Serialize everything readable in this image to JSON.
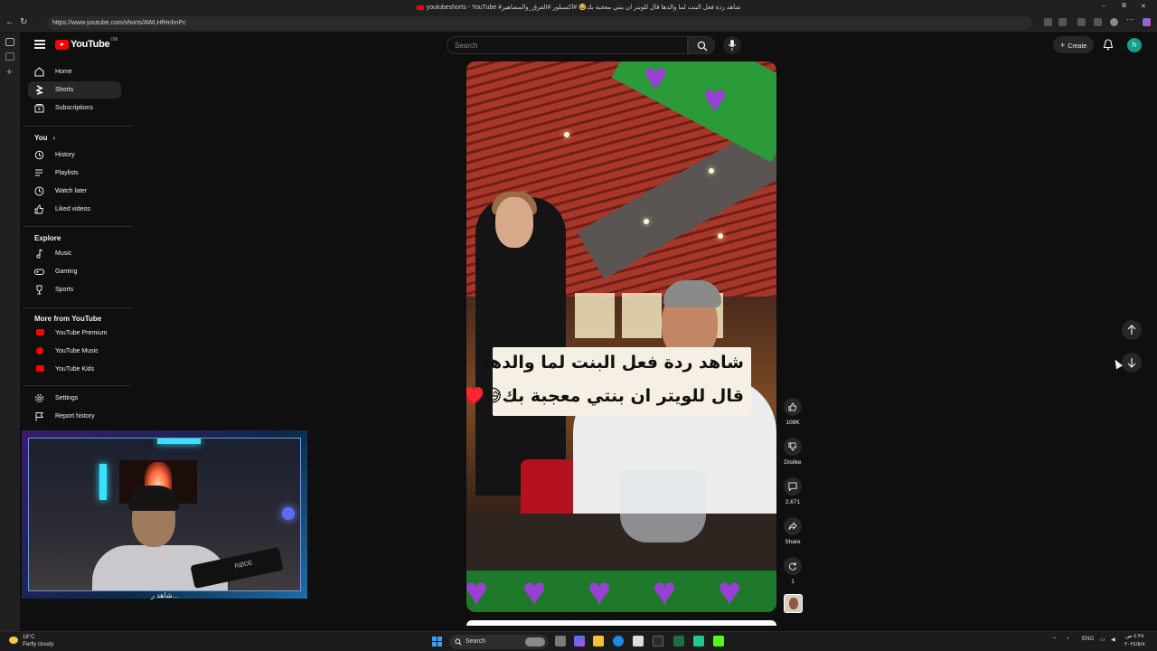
{
  "browser": {
    "tab_title": "youtubeshorts - YouTube #شاهد ردة فعل البنت لما والدها قال للويتر ان بنتي معجبة بك😂 #اكسبلور #الفرق_والمشاهير",
    "url": "https://www.youtube.com/shorts/AWLHfHnhnPc",
    "window_controls": [
      "–",
      "⧉",
      "✕"
    ]
  },
  "header": {
    "logo_text": "YouTube",
    "logo_region": "OM",
    "search_placeholder": "Search",
    "create_label": "Create",
    "avatar_letter": "h"
  },
  "sidebar": {
    "main": [
      {
        "label": "Home",
        "icon": "home-icon"
      },
      {
        "label": "Shorts",
        "icon": "shorts-icon",
        "active": true
      },
      {
        "label": "Subscriptions",
        "icon": "subscriptions-icon"
      }
    ],
    "you_heading": "You",
    "you": [
      {
        "label": "History",
        "icon": "history-icon"
      },
      {
        "label": "Playlists",
        "icon": "playlists-icon"
      },
      {
        "label": "Watch later",
        "icon": "clock-icon"
      },
      {
        "label": "Liked videos",
        "icon": "thumbs-up-icon"
      }
    ],
    "explore_heading": "Explore",
    "explore": [
      {
        "label": "Music",
        "icon": "music-note-icon"
      },
      {
        "label": "Gaming",
        "icon": "gamepad-icon"
      },
      {
        "label": "Sports",
        "icon": "trophy-icon"
      }
    ],
    "more_heading": "More from YouTube",
    "more": [
      {
        "label": "YouTube Premium"
      },
      {
        "label": "YouTube Music"
      },
      {
        "label": "YouTube Kids"
      }
    ],
    "settings": [
      {
        "label": "Settings",
        "icon": "gear-icon"
      },
      {
        "label": "Report history",
        "icon": "flag-icon"
      }
    ]
  },
  "short": {
    "caption_line1": "شاهد ردة فعل البنت لما والدها",
    "caption_line2": "قال للويتر ان بنتي معجبة بك😅♥️",
    "mic_text": "RØDE"
  },
  "actions": {
    "likes": "108K",
    "dislike": "Dislike",
    "comments": "2,671",
    "share": "Share",
    "remix": "1"
  },
  "webcam_caption": "...شاهد ر",
  "taskbar": {
    "temp": "18°C",
    "weather": "Partly cloudy",
    "search": "Search",
    "lang": "ENG",
    "time": "٤:٢٨ ص",
    "date": "٢٠٢٤/٥/٨"
  },
  "colors": {
    "bg": "#0f0f0f",
    "accent_red": "#ff0000",
    "avatar": "#12a08a",
    "caption_bg": "#f5efe4",
    "hearts": "#9a3fd6",
    "heart_band": "#1e7a2a"
  }
}
